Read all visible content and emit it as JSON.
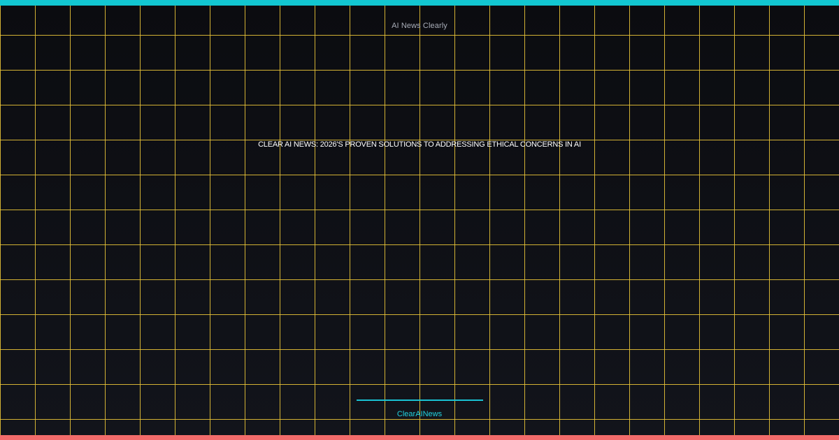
{
  "site": {
    "name": "AI News Clearly"
  },
  "headline": {
    "text": "CLEAR AI NEWS: 2026'S PROVEN SOLUTIONS TO ADDRESSING ETHICAL CONCERNS IN AI"
  },
  "footer": {
    "brand": "ClearAINews"
  },
  "colors": {
    "background": "#0e0f14",
    "grid_line": "#e8c337",
    "top_bar": "#12c7d1",
    "bottom_bar": "#f26b6b",
    "headline_text": "#ffffff",
    "site_name_text": "#a9adb8",
    "accent": "#22d3e0"
  }
}
